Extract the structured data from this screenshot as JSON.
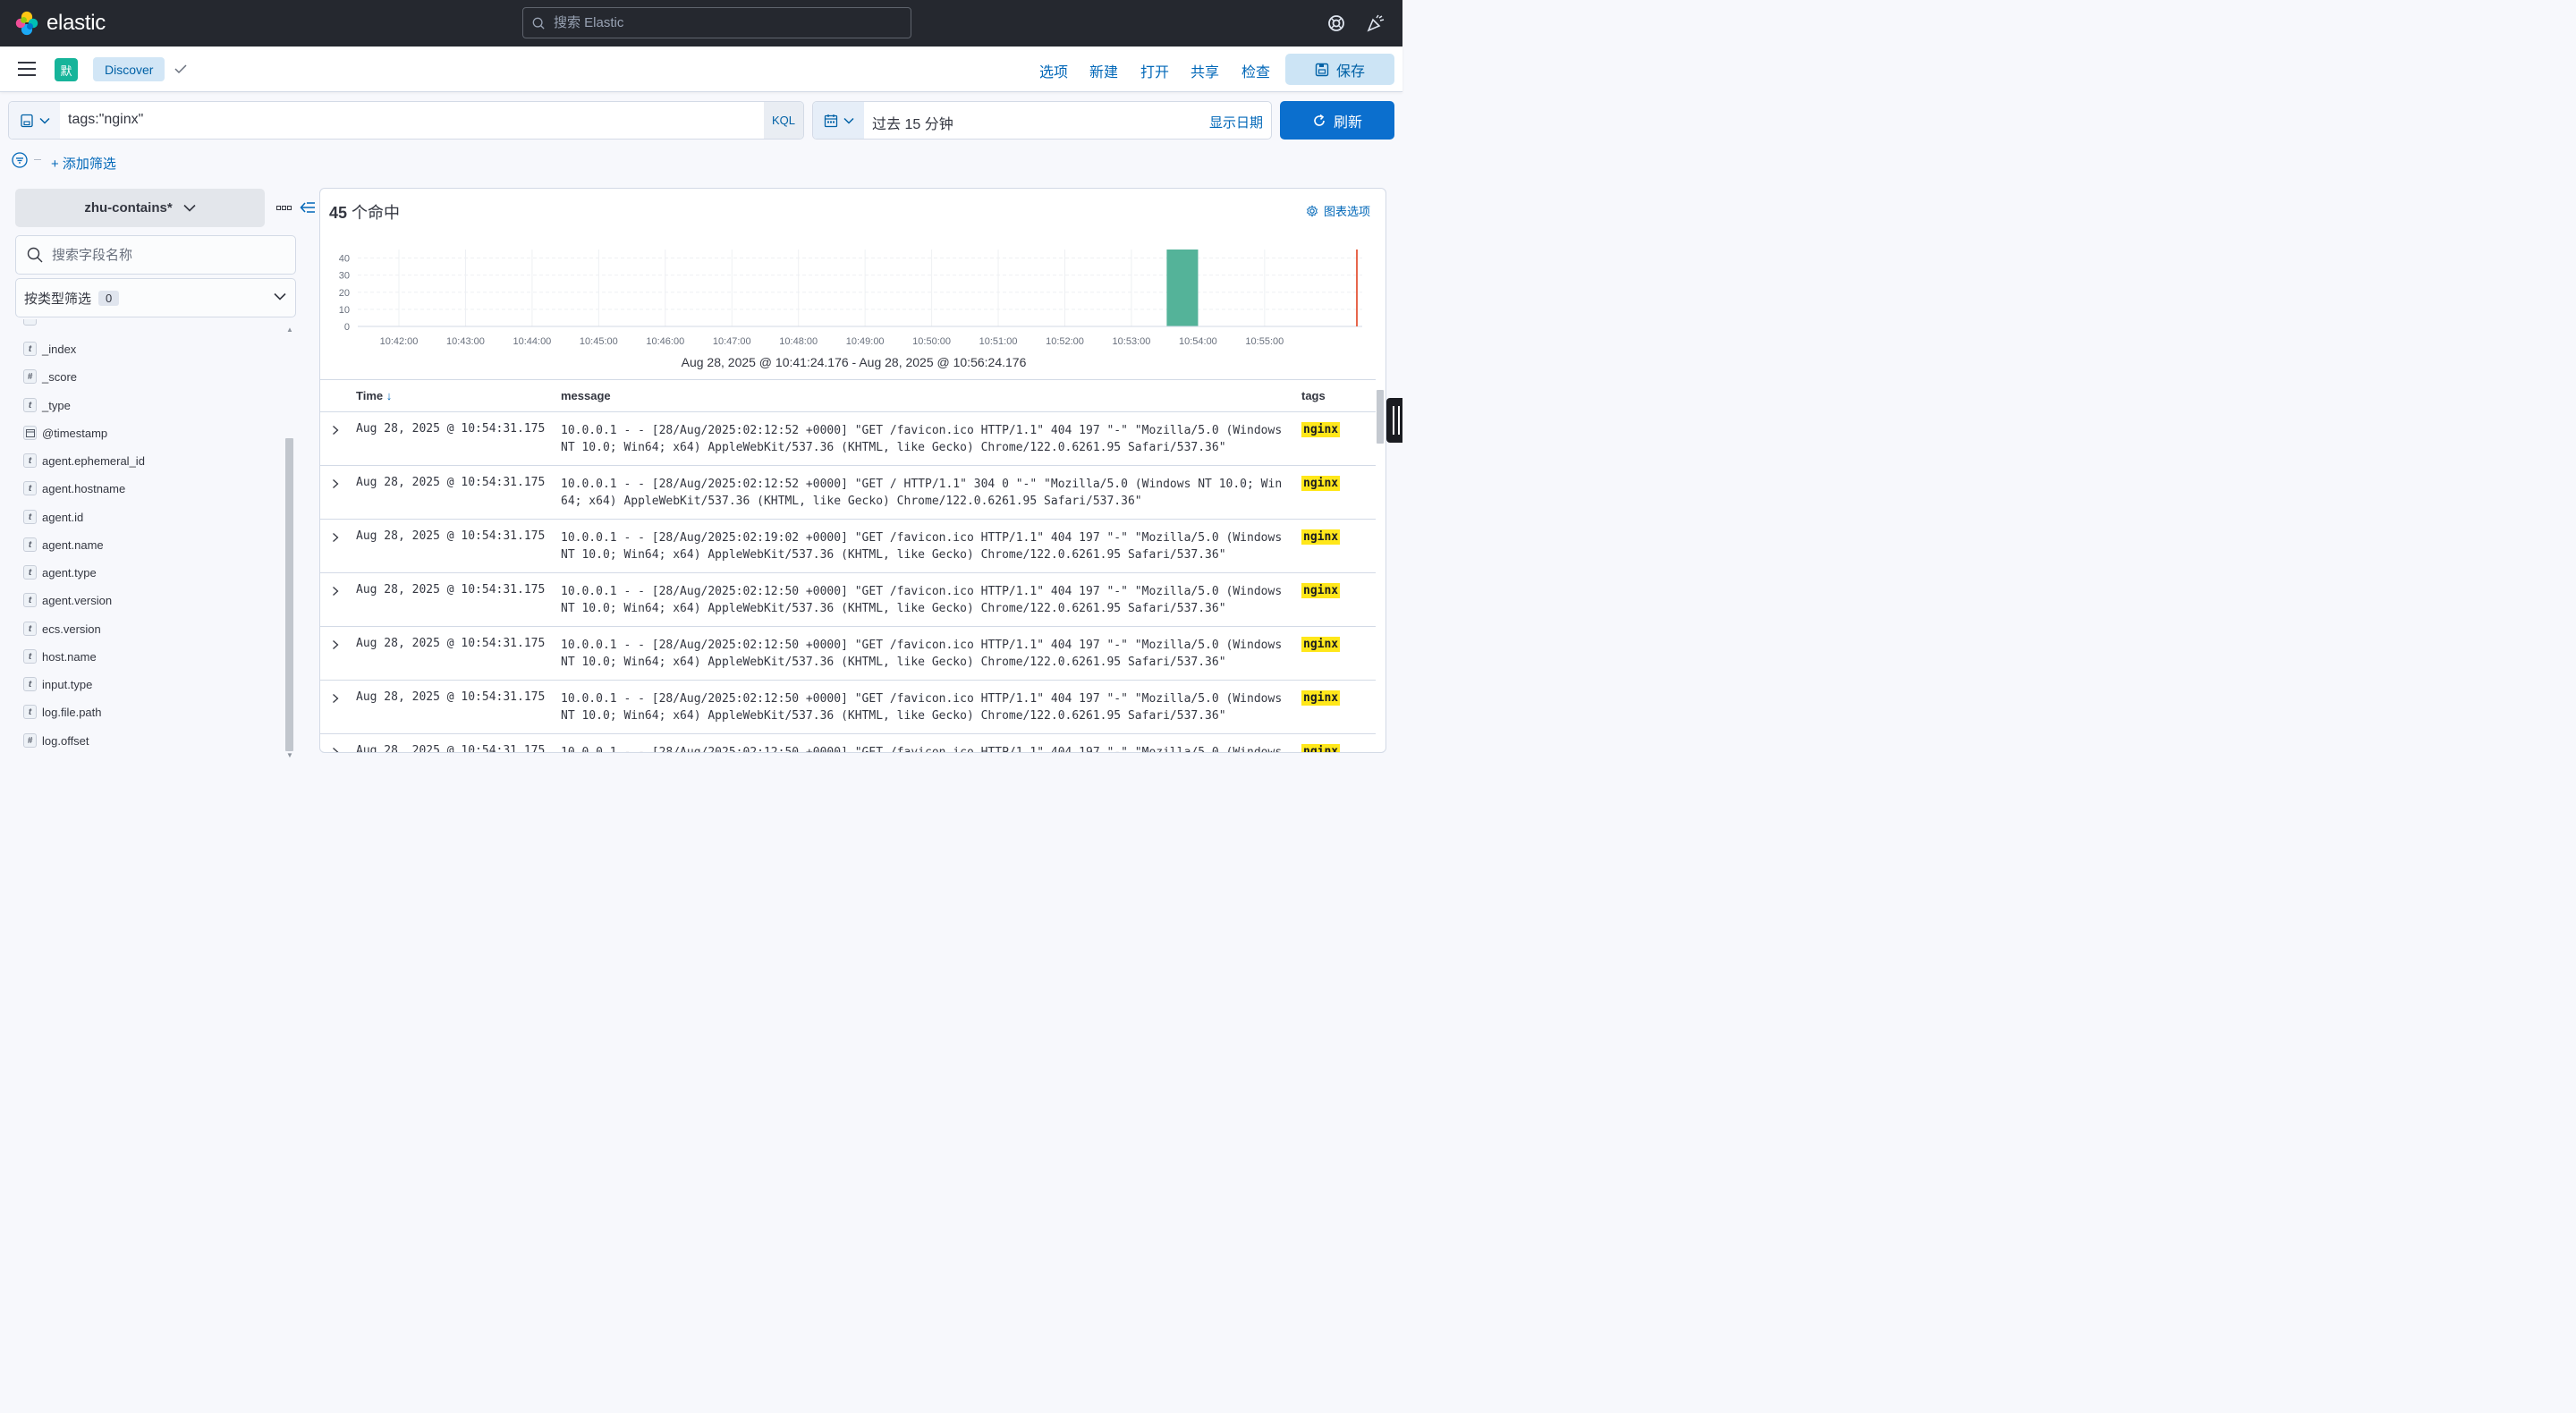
{
  "header": {
    "logo_text": "elastic",
    "search_placeholder": "搜索 Elastic"
  },
  "app_bar": {
    "space_initial": "默",
    "breadcrumb": "Discover",
    "links": [
      "选项",
      "新建",
      "打开",
      "共享",
      "检查"
    ],
    "save_label": "保存"
  },
  "query": {
    "text": "tags:\"nginx\"",
    "language": "KQL"
  },
  "time": {
    "range_label": "过去 15 分钟",
    "show_dates": "显示日期",
    "refresh_label": "刷新"
  },
  "filters": {
    "add_label": "+ 添加筛选"
  },
  "sidebar": {
    "index_pattern": "zhu-contains*",
    "field_search_placeholder": "搜索字段名称",
    "type_filter_label": "按类型筛选",
    "type_filter_count": "0",
    "fields": [
      {
        "type": "t",
        "name": "_index"
      },
      {
        "type": "#",
        "name": "_score"
      },
      {
        "type": "t",
        "name": "_type"
      },
      {
        "type": "date",
        "name": "@timestamp"
      },
      {
        "type": "t",
        "name": "agent.ephemeral_id"
      },
      {
        "type": "t",
        "name": "agent.hostname"
      },
      {
        "type": "t",
        "name": "agent.id"
      },
      {
        "type": "t",
        "name": "agent.name"
      },
      {
        "type": "t",
        "name": "agent.type"
      },
      {
        "type": "t",
        "name": "agent.version"
      },
      {
        "type": "t",
        "name": "ecs.version"
      },
      {
        "type": "t",
        "name": "host.name"
      },
      {
        "type": "t",
        "name": "input.type"
      },
      {
        "type": "t",
        "name": "log.file.path"
      },
      {
        "type": "#",
        "name": "log.offset"
      }
    ]
  },
  "main": {
    "hits_count": "45",
    "hits_label": "个命中",
    "chart_options_label": "图表选项",
    "range_text": "Aug 28, 2025 @ 10:41:24.176 - Aug 28, 2025 @ 10:56:24.176",
    "columns": [
      "Time",
      "message",
      "tags"
    ],
    "rows": [
      {
        "time": "Aug 28, 2025 @ 10:54:31.175",
        "message": "10.0.0.1 - - [28/Aug/2025:02:12:52 +0000] \"GET /favicon.ico HTTP/1.1\" 404 197 \"-\" \"Mozilla/5.0 (Windows NT 10.0; Win64; x64) AppleWebKit/537.36 (KHTML, like Gecko) Chrome/122.0.6261.95 Safari/537.36\"",
        "tag": "nginx"
      },
      {
        "time": "Aug 28, 2025 @ 10:54:31.175",
        "message": "10.0.0.1 - - [28/Aug/2025:02:12:52 +0000] \"GET / HTTP/1.1\" 304 0 \"-\" \"Mozilla/5.0 (Windows NT 10.0; Win64; x64) AppleWebKit/537.36 (KHTML, like Gecko) Chrome/122.0.6261.95 Safari/537.36\"",
        "tag": "nginx"
      },
      {
        "time": "Aug 28, 2025 @ 10:54:31.175",
        "message": "10.0.0.1 - - [28/Aug/2025:02:19:02 +0000] \"GET /favicon.ico HTTP/1.1\" 404 197 \"-\" \"Mozilla/5.0 (Windows NT 10.0; Win64; x64) AppleWebKit/537.36 (KHTML, like Gecko) Chrome/122.0.6261.95 Safari/537.36\"",
        "tag": "nginx"
      },
      {
        "time": "Aug 28, 2025 @ 10:54:31.175",
        "message": "10.0.0.1 - - [28/Aug/2025:02:12:50 +0000] \"GET /favicon.ico HTTP/1.1\" 404 197 \"-\" \"Mozilla/5.0 (Windows NT 10.0; Win64; x64) AppleWebKit/537.36 (KHTML, like Gecko) Chrome/122.0.6261.95 Safari/537.36\"",
        "tag": "nginx"
      },
      {
        "time": "Aug 28, 2025 @ 10:54:31.175",
        "message": "10.0.0.1 - - [28/Aug/2025:02:12:50 +0000] \"GET /favicon.ico HTTP/1.1\" 404 197 \"-\" \"Mozilla/5.0 (Windows NT 10.0; Win64; x64) AppleWebKit/537.36 (KHTML, like Gecko) Chrome/122.0.6261.95 Safari/537.36\"",
        "tag": "nginx"
      },
      {
        "time": "Aug 28, 2025 @ 10:54:31.175",
        "message": "10.0.0.1 - - [28/Aug/2025:02:12:50 +0000] \"GET /favicon.ico HTTP/1.1\" 404 197 \"-\" \"Mozilla/5.0 (Windows NT 10.0; Win64; x64) AppleWebKit/537.36 (KHTML, like Gecko) Chrome/122.0.6261.95 Safari/537.36\"",
        "tag": "nginx"
      },
      {
        "time": "Aug 28, 2025 @ 10:54:31.175",
        "message": "10.0.0.1 - - [28/Aug/2025:02:12:50 +0000] \"GET /favicon.ico HTTP/1.1\" 404 197 \"-\" \"Mozilla/5.0 (Windows",
        "tag": "nginx"
      }
    ]
  },
  "chart_data": {
    "type": "bar",
    "categories": [
      "10:42:00",
      "10:43:00",
      "10:44:00",
      "10:45:00",
      "10:46:00",
      "10:47:00",
      "10:48:00",
      "10:49:00",
      "10:50:00",
      "10:51:00",
      "10:52:00",
      "10:53:00",
      "10:54:00",
      "10:55:00"
    ],
    "values": [
      0,
      0,
      0,
      0,
      0,
      0,
      0,
      0,
      0,
      0,
      0,
      0,
      45,
      0
    ],
    "y_ticks": [
      0,
      10,
      20,
      30,
      40
    ],
    "ylim": [
      0,
      45
    ],
    "grid": true,
    "bar_color": "#54b399",
    "now_marker_color": "#e7664c"
  }
}
